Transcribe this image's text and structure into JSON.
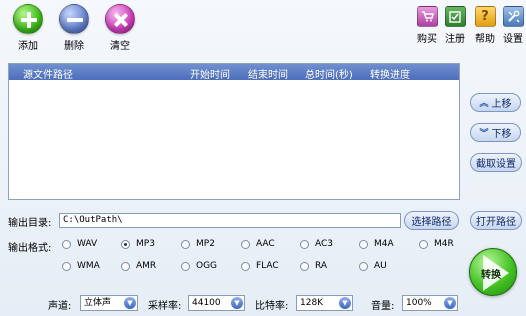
{
  "toolbar": {
    "add": "添加",
    "delete": "删除",
    "clear": "清空"
  },
  "top_right": {
    "buy": "购买",
    "register": "注册",
    "help": "帮助",
    "settings": "设置",
    "help_glyph": "?"
  },
  "list": {
    "columns": [
      "源文件路径",
      "开始时间",
      "结束时间",
      "总时间(秒)",
      "转换进度"
    ],
    "rows": []
  },
  "side_buttons": {
    "move_up": "上移",
    "move_down": "下移",
    "intercept_settings": "截取设置",
    "open_path": "打开路径"
  },
  "output": {
    "dir_label": "输出目录:",
    "dir_value": "C:\\OutPath\\",
    "choose_path": "选择路径",
    "format_label": "输出格式:",
    "formats_row1": [
      "WAV",
      "MP3",
      "MP2",
      "AAC",
      "AC3",
      "M4A",
      "M4R"
    ],
    "formats_row2": [
      "WMA",
      "AMR",
      "OGG",
      "FLAC",
      "RA",
      "AU"
    ],
    "selected_format": "MP3"
  },
  "convert": {
    "label": "转换"
  },
  "audio": {
    "channel_label": "声道:",
    "channel_value": "立体声",
    "samplerate_label": "采样率:",
    "samplerate_value": "44100",
    "bitrate_label": "比特率:",
    "bitrate_value": "128K",
    "volume_label": "音量:",
    "volume_value": "100%"
  },
  "icons": {
    "add": "plus-circle-icon",
    "delete": "minus-circle-icon",
    "clear": "x-circle-icon",
    "buy": "cart-icon",
    "register": "register-icon",
    "help": "help-icon",
    "settings": "settings-icon",
    "move_up": "chevron-up-icon",
    "move_down": "chevron-down-icon",
    "convert": "play-icon"
  }
}
